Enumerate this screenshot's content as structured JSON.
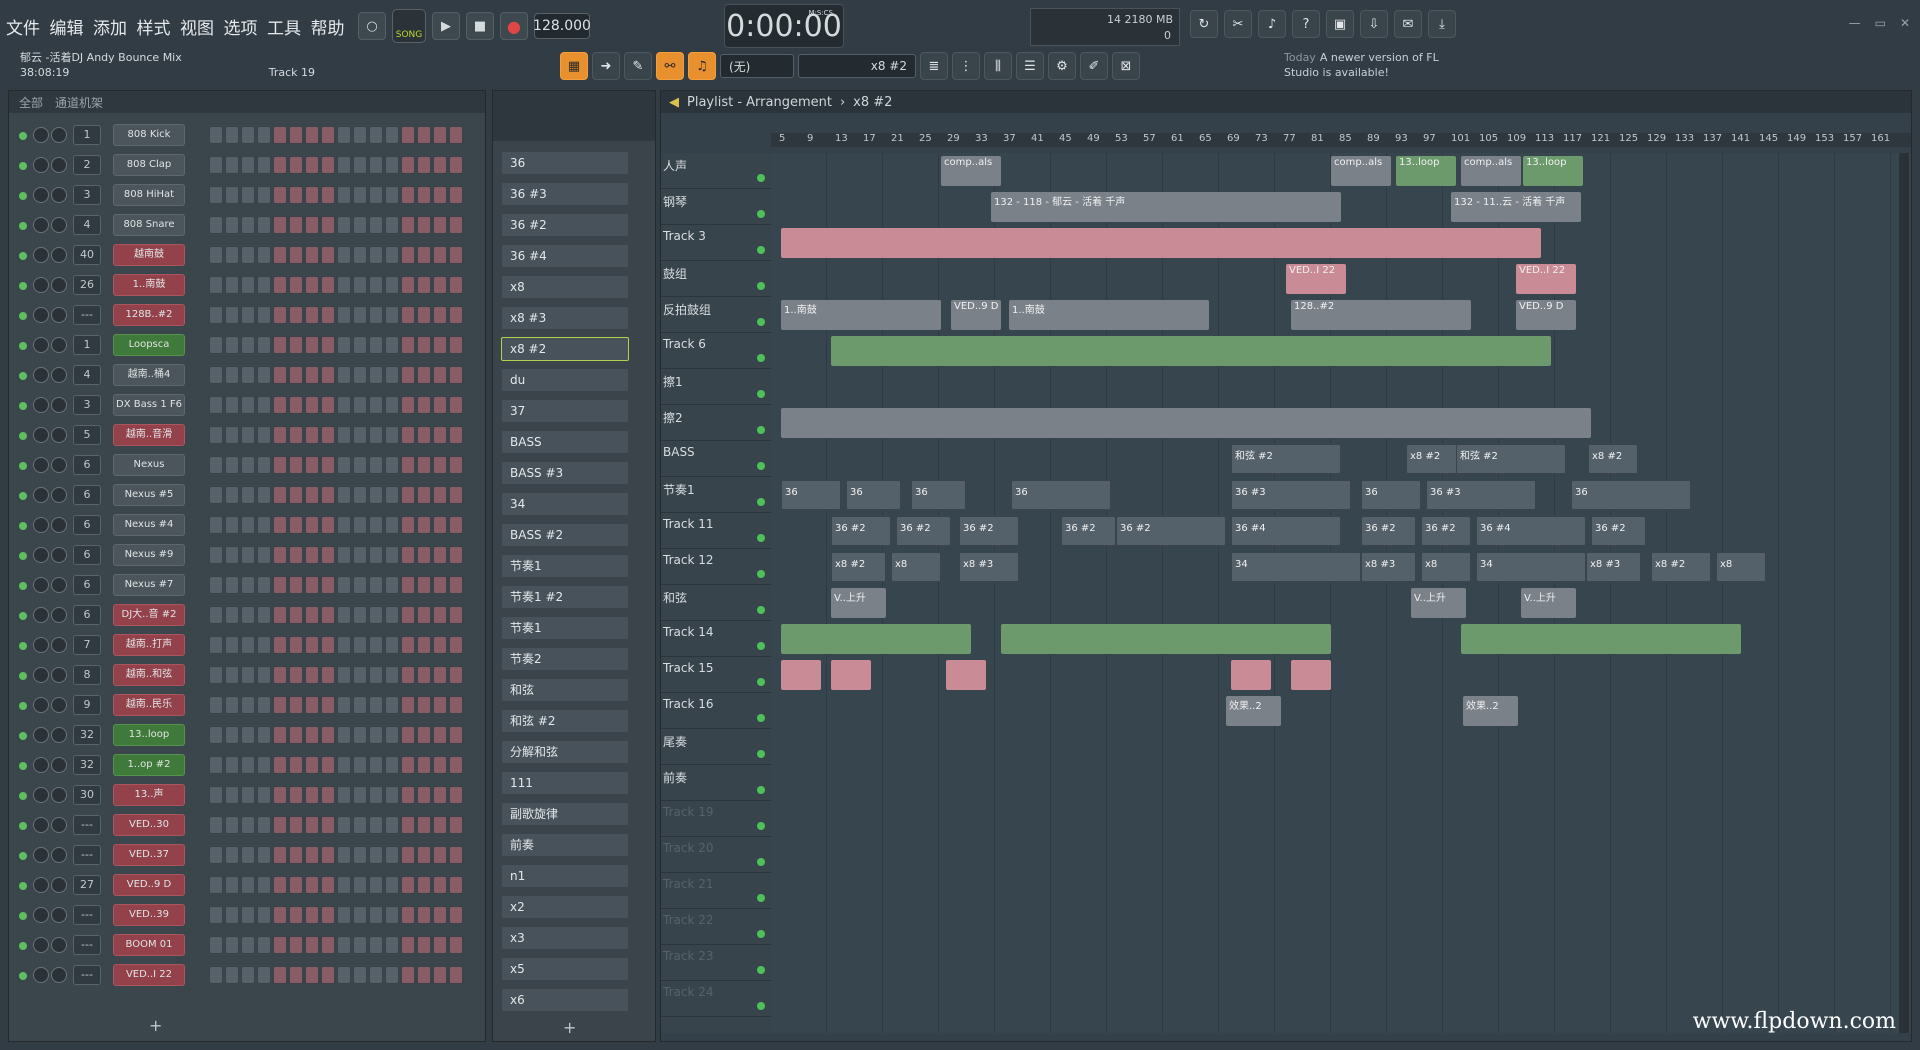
{
  "menu": [
    "文件",
    "编辑",
    "添加",
    "样式",
    "视图",
    "选项",
    "工具",
    "帮助"
  ],
  "song": {
    "title": "郁云 -活着DJ Andy Bounce Mix",
    "time": "38:08:19",
    "track": "Track 19"
  },
  "transport": {
    "song_label": "SONG",
    "tempo": "128.000",
    "time": "0:00:00",
    "time_unit": "M:S:CS"
  },
  "cpu": {
    "voices": "14",
    "mem": "2180 MB",
    "zero": "0"
  },
  "pattern_selector": {
    "none": "(无)",
    "current": "x8 #2"
  },
  "news": {
    "day": "Today",
    "text": "A newer version of FL Studio is available!"
  },
  "rack": {
    "title": "通道机架",
    "group": "全部",
    "channels": [
      {
        "num": "1",
        "name": "808 Kick",
        "color": "grey"
      },
      {
        "num": "2",
        "name": "808 Clap",
        "color": "grey"
      },
      {
        "num": "3",
        "name": "808 HiHat",
        "color": "grey"
      },
      {
        "num": "4",
        "name": "808 Snare",
        "color": "grey"
      },
      {
        "num": "40",
        "name": "越南鼓",
        "color": "red"
      },
      {
        "num": "26",
        "name": "1..南鼓",
        "color": "red"
      },
      {
        "num": "---",
        "name": "128B..#2",
        "color": "red"
      },
      {
        "num": "1",
        "name": "Loopsca",
        "color": "green"
      },
      {
        "num": "4",
        "name": "越南..桶4",
        "color": "grey"
      },
      {
        "num": "3",
        "name": "DX Bass 1 F6",
        "color": "grey"
      },
      {
        "num": "5",
        "name": "越南..音滑",
        "color": "red"
      },
      {
        "num": "6",
        "name": "Nexus",
        "color": "grey"
      },
      {
        "num": "6",
        "name": "Nexus #5",
        "color": "grey"
      },
      {
        "num": "6",
        "name": "Nexus #4",
        "color": "grey"
      },
      {
        "num": "6",
        "name": "Nexus #9",
        "color": "grey"
      },
      {
        "num": "6",
        "name": "Nexus #7",
        "color": "grey"
      },
      {
        "num": "6",
        "name": "DJ大..音 #2",
        "color": "red"
      },
      {
        "num": "7",
        "name": "越南..打声",
        "color": "red"
      },
      {
        "num": "8",
        "name": "越南..和弦",
        "color": "red"
      },
      {
        "num": "9",
        "name": "越南..民乐",
        "color": "red"
      },
      {
        "num": "32",
        "name": "13..loop",
        "color": "green"
      },
      {
        "num": "32",
        "name": "1..op #2",
        "color": "green"
      },
      {
        "num": "30",
        "name": "13..声",
        "color": "red"
      },
      {
        "num": "---",
        "name": "VED..30",
        "color": "red"
      },
      {
        "num": "---",
        "name": "VED..37",
        "color": "red"
      },
      {
        "num": "27",
        "name": "VED..9 D",
        "color": "red"
      },
      {
        "num": "---",
        "name": "VED..39",
        "color": "red"
      },
      {
        "num": "---",
        "name": "BOOM 01",
        "color": "red"
      },
      {
        "num": "---",
        "name": "VED..I 22",
        "color": "red"
      }
    ]
  },
  "patterns": [
    "36",
    "36 #3",
    "36 #2",
    "36 #4",
    "x8",
    "x8 #3",
    "x8 #2",
    "du",
    "37",
    "BASS",
    "BASS #3",
    "34",
    "BASS #2",
    "节奏1",
    "节奏1 #2",
    "节奏1",
    "节奏2",
    "和弦",
    "和弦 #2",
    "分解和弦",
    "111",
    "副歌旋律",
    "前奏",
    "n1",
    "x2",
    "x3",
    "x5",
    "x6"
  ],
  "playlist": {
    "title": "Playlist - Arrangement",
    "breadcrumb": "x8 #2",
    "ruler": [
      "5",
      "9",
      "13",
      "17",
      "21",
      "25",
      "29",
      "33",
      "37",
      "41",
      "45",
      "49",
      "53",
      "57",
      "61",
      "65",
      "69",
      "73",
      "77",
      "81",
      "85",
      "89",
      "93",
      "97",
      "101",
      "105",
      "109",
      "113",
      "117",
      "121",
      "125",
      "129",
      "133",
      "137",
      "141",
      "145",
      "149",
      "153",
      "157",
      "161"
    ],
    "tracks": [
      "人声",
      "钢琴",
      "Track 3",
      "鼓组",
      "反拍鼓组",
      "Track 6",
      "擦1",
      "擦2",
      "BASS",
      "节奏1",
      "Track 11",
      "Track 12",
      "和弦",
      "Track 14",
      "Track 15",
      "Track 16",
      "尾奏",
      "前奏",
      "Track 19",
      "Track 20",
      "Track 21",
      "Track 22",
      "Track 23",
      "Track 24"
    ],
    "clip_labels": [
      "comp..als",
      "13..loop",
      "132 - 118 - 郁云 - 活着 千声",
      "132 - 11..云 - 活着 千声",
      "VED..I 22",
      "1..南鼓",
      "128..#2",
      "VED..9 D",
      "和弦 #2",
      "x8 #2",
      "36",
      "36 #3",
      "36 #2",
      "36 #4",
      "x8",
      "x8 #3",
      "34",
      "V..上升",
      "效果..2"
    ]
  },
  "watermark": "www.flpdown.com"
}
